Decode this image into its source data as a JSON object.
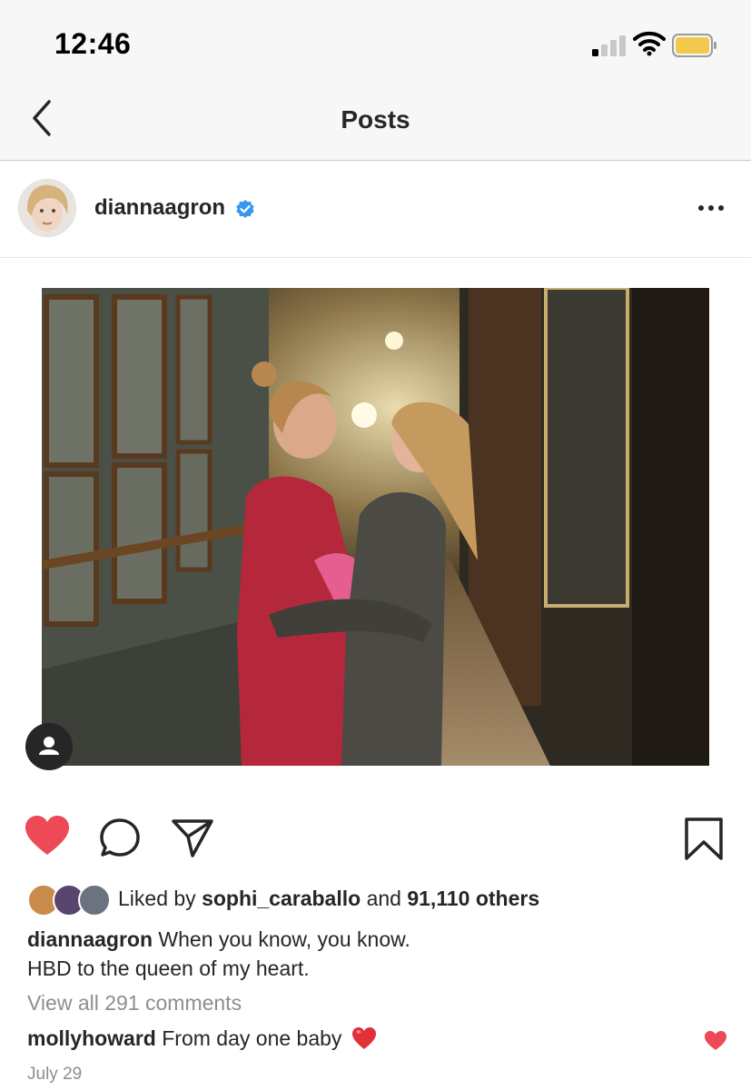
{
  "status_bar": {
    "time": "12:46",
    "signal_icon": "cellular-signal-icon",
    "wifi_icon": "wifi-icon",
    "battery_icon": "battery-icon",
    "battery_color": "#f2c94c"
  },
  "nav": {
    "title": "Posts",
    "back_icon": "chevron-left-icon"
  },
  "post": {
    "username": "diannaagron",
    "verified_icon": "verified-badge-icon",
    "more_icon": "ellipsis-icon",
    "photo_alt": "photo",
    "tag_icon": "user-tag-icon",
    "actions": {
      "like_icon": "heart-filled-icon",
      "comment_icon": "comment-icon",
      "share_icon": "send-icon",
      "save_icon": "bookmark-icon",
      "like_color": "#ed4956"
    },
    "likes": {
      "prefix": "Liked by",
      "user": "sophi_caraballo",
      "joiner": "and",
      "others": "91,110 others"
    },
    "caption": {
      "user": "diannaagron",
      "line1": "When you know, you know.",
      "line2": "HBD to the queen of my heart."
    },
    "view_comments": "View all 291 comments",
    "comment": {
      "user": "mollyhoward",
      "text": "From day one baby"
    },
    "date": "July 29"
  }
}
